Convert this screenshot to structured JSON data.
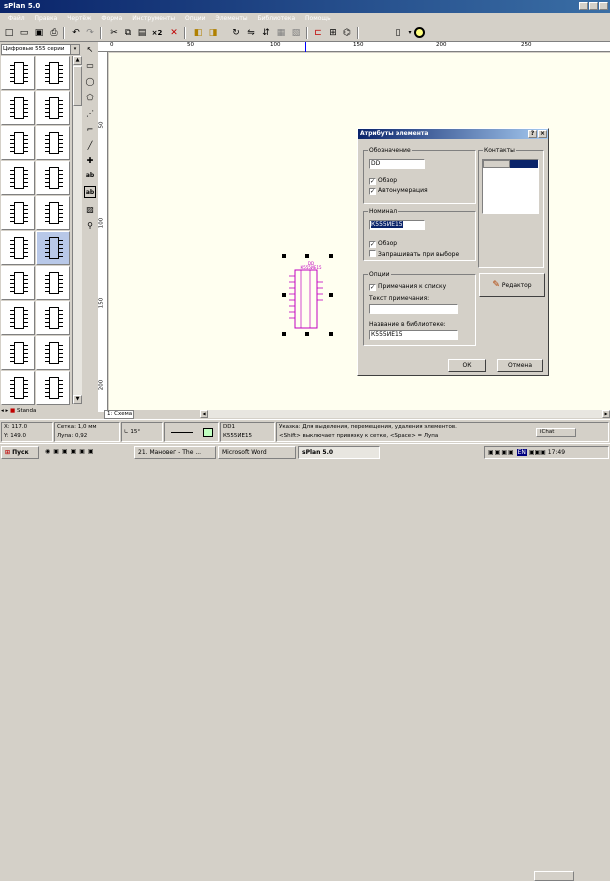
{
  "app": {
    "title": "sPlan 5.0"
  },
  "menu": [
    "Файл",
    "Правка",
    "Чертёж",
    "Форма",
    "Инструменты",
    "Опции",
    "Элементы",
    "Библиотека",
    "Помощь"
  ],
  "toolbar": {
    "x2_label": "×2"
  },
  "library": {
    "selected": "Цифровые 555 серии",
    "tab": "Standa"
  },
  "ruler": {
    "top_ticks": [
      "0",
      "50",
      "100",
      "150",
      "200",
      "250"
    ],
    "left_ticks": [
      "50",
      "100",
      "150",
      "200"
    ]
  },
  "canvas": {
    "tab": "1: Схема",
    "part": {
      "ref": "DD",
      "name": "К555ИЕ15"
    }
  },
  "dialog": {
    "title": "Атрибуты элемента",
    "help_btn": "?",
    "close_btn": "×",
    "designation": {
      "group": "Обозначение",
      "value": "DD",
      "cb_show": "Обзор",
      "cb_auto": "Автонумерация"
    },
    "contacts": {
      "group": "Контакты"
    },
    "nominal": {
      "group": "Номинал",
      "value": "К555ИЕ15",
      "cb_show": "Обзор",
      "cb_ask": "Запрашивать при выборе"
    },
    "options": {
      "group": "Опции",
      "cb_notes": "Примечания к списку",
      "notes_label": "Текст примечания:",
      "notes_value": "",
      "libname_label": "Название в библиотеке:",
      "libname_value": "К555ИЕ15"
    },
    "editor_btn": "Редактор",
    "ok_btn": "ОК",
    "cancel_btn": "Отмена"
  },
  "status": {
    "x": "X: 117.0",
    "y": "Y: 149.0",
    "grid": "Сетка: 1,0 мм",
    "zoom": "Лупа: 0,92",
    "angle": "15°",
    "part_ref": "DD1",
    "part_name": "К555ИЕ15",
    "hint1": "Указка: Для выделения, перемещения, удаления элементов.",
    "hint2": "<Shift> выключает привязку к сетке, <Space> = Лупа"
  },
  "taskbar": {
    "start": "Пуск",
    "tasks": [
      "21. Мановег - The ...",
      "Microsoft Word",
      "sPlan 5.0"
    ],
    "tray_app": "iChat",
    "tray_lang": "EN",
    "clock": "17:49"
  }
}
